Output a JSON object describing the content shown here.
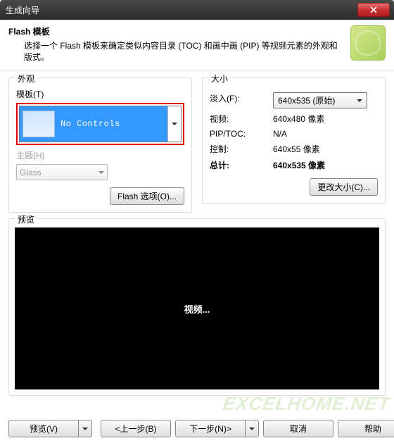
{
  "window": {
    "title": "生成向导"
  },
  "header": {
    "title": "Flash 模板",
    "desc": "选择一个 Flash  模板来确定类似内容目录 (TOC) 和画中画 (PIP) 等视频元素的外观和版式。"
  },
  "appearance": {
    "legend": "外观",
    "template_label": "模板(T)",
    "template_value": "No Controls",
    "theme_label": "主题(H)",
    "theme_value": "Glass",
    "flash_options_btn": "Flash 选项(O)..."
  },
  "size": {
    "legend": "大小",
    "fadein_label": "淡入(F):",
    "fadein_value": "640x535 (原始)",
    "video_label": "视频:",
    "video_value": "640x480 像素",
    "piptoc_label": "PIP/TOC:",
    "piptoc_value": "N/A",
    "control_label": "控制:",
    "control_value": "640x55 像素",
    "total_label": "总计:",
    "total_value": "640x535 像素",
    "change_size_btn": "更改大小(C)..."
  },
  "preview": {
    "legend": "预览",
    "placeholder": "视频..."
  },
  "footer": {
    "preview_btn": "预览(V)",
    "back_btn": "<上一步(B)",
    "next_btn": "下一步(N)>",
    "cancel_btn": "取消",
    "help_btn": "帮助"
  },
  "watermark": "EXCELHOME.NET"
}
